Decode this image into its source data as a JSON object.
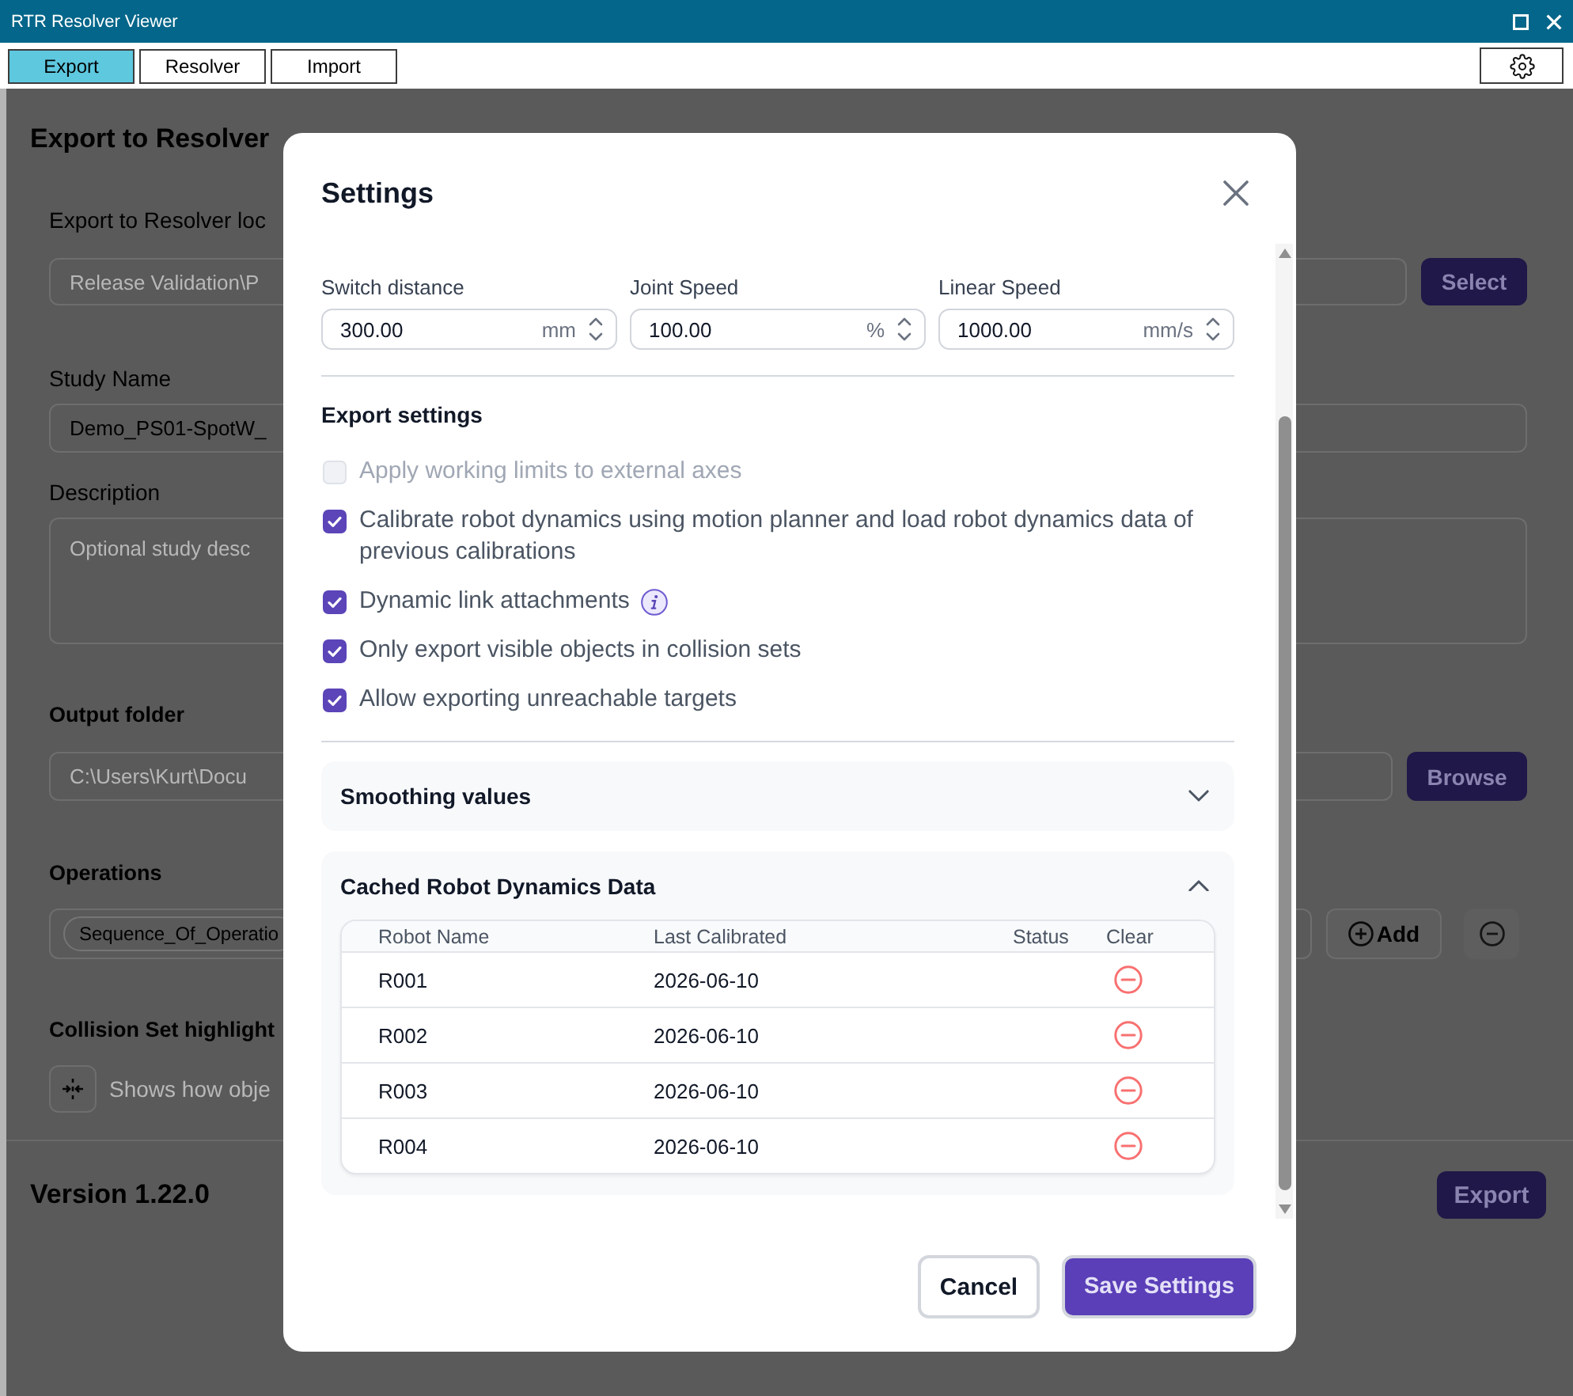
{
  "window": {
    "title": "RTR Resolver Viewer"
  },
  "toolbar": {
    "tabs": [
      {
        "label": "Export",
        "selected": true
      },
      {
        "label": "Resolver",
        "selected": false
      },
      {
        "label": "Import",
        "selected": false
      }
    ]
  },
  "page": {
    "heading": "Export to Resolver",
    "details": [
      {
        "kind": "field",
        "label": "Export to Resolver loc",
        "value": "Release Validation\\P",
        "disabled": true,
        "button": "Select"
      },
      {
        "kind": "field",
        "label": "Study Name",
        "value": "Demo_PS01-SpotW_",
        "disabled": false
      },
      {
        "kind": "area",
        "label": "Description",
        "placeholder": "Optional study desc"
      }
    ],
    "sections": [
      {
        "kind": "field",
        "label": "Output folder",
        "value": "C:\\Users\\Kurt\\Docu",
        "disabled": true,
        "button": "Browse"
      },
      {
        "kind": "chips",
        "label": "Operations",
        "chips": [
          "Sequence_Of_Operatio"
        ],
        "button": "Add"
      },
      {
        "kind": "toggle",
        "label": "Collision Set highlight",
        "description": "Shows how obje"
      }
    ],
    "version": "Version 1.22.0",
    "export_button": "Export"
  },
  "dialog": {
    "title": "Settings",
    "motion_fields": [
      {
        "label": "Switch distance",
        "value": "300.00",
        "unit": "mm"
      },
      {
        "label": "Joint Speed",
        "value": "100.00",
        "unit": "%"
      },
      {
        "label": "Linear Speed",
        "value": "1000.00",
        "unit": "mm/s"
      }
    ],
    "export_settings": {
      "title": "Export settings",
      "options": [
        {
          "label": "Apply working limits to external axes",
          "checked": false,
          "disabled": true,
          "info": false
        },
        {
          "label": "Calibrate robot dynamics using motion planner and load robot dynamics data of previous calibrations",
          "checked": true,
          "disabled": false,
          "info": false
        },
        {
          "label": "Dynamic link attachments",
          "checked": true,
          "disabled": false,
          "info": true
        },
        {
          "label": "Only export visible objects in collision sets",
          "checked": true,
          "disabled": false,
          "info": false
        },
        {
          "label": "Allow exporting unreachable targets",
          "checked": true,
          "disabled": false,
          "info": false
        }
      ]
    },
    "accordions": [
      {
        "title": "Smoothing values",
        "expanded": false
      },
      {
        "title": "Cached Robot Dynamics Data",
        "expanded": true,
        "table": {
          "columns": [
            "Robot Name",
            "Last Calibrated",
            "Status",
            "Clear"
          ],
          "rows": [
            {
              "robot_name": "R001",
              "last_calibrated": "2026-06-10"
            },
            {
              "robot_name": "R002",
              "last_calibrated": "2026-06-10"
            },
            {
              "robot_name": "R003",
              "last_calibrated": "2026-06-10"
            },
            {
              "robot_name": "R004",
              "last_calibrated": "2026-06-10"
            }
          ]
        }
      }
    ],
    "buttons": [
      {
        "label": "Cancel",
        "kind": "secondary"
      },
      {
        "label": "Save Settings",
        "kind": "primary"
      }
    ]
  }
}
